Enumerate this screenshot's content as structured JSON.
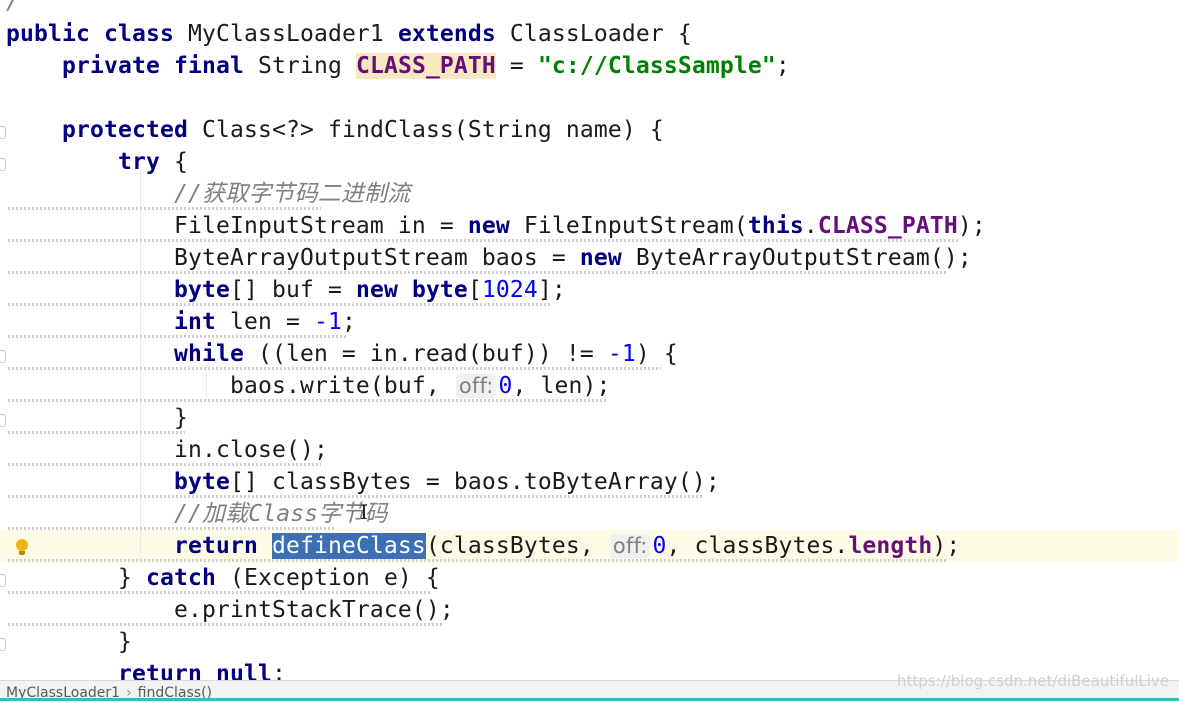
{
  "editor": {
    "lines": [
      {
        "tokens": [
          {
            "t": "/",
            "c": "cm"
          }
        ]
      },
      {
        "tokens": [
          {
            "t": "public class ",
            "c": "kw"
          },
          {
            "t": "MyClassLoader1 "
          },
          {
            "t": "extends ",
            "c": "kw"
          },
          {
            "t": "ClassLoader {"
          }
        ]
      },
      {
        "tokens": [
          {
            "t": "    "
          },
          {
            "t": "private final ",
            "c": "kw"
          },
          {
            "t": "String "
          },
          {
            "t": "CLASS_PATH",
            "c": "fld hl-const"
          },
          {
            "t": " = "
          },
          {
            "t": "\"c://ClassSample\"",
            "c": "st"
          },
          {
            "t": ";"
          }
        ]
      },
      {
        "tokens": []
      },
      {
        "tokens": [
          {
            "t": "    "
          },
          {
            "t": "protected ",
            "c": "kw"
          },
          {
            "t": "Class<?> findClass(String name) {"
          }
        ]
      },
      {
        "tokens": [
          {
            "t": "        "
          },
          {
            "t": "try ",
            "c": "kw"
          },
          {
            "t": "{"
          }
        ]
      },
      {
        "tokens": [
          {
            "t": "            "
          },
          {
            "t": "//获取字节码二进制流",
            "c": "cm"
          }
        ]
      },
      {
        "tokens": [
          {
            "t": "            FileInputStream in = "
          },
          {
            "t": "new ",
            "c": "kw"
          },
          {
            "t": "FileInputStream("
          },
          {
            "t": "this",
            "c": "kw"
          },
          {
            "t": "."
          },
          {
            "t": "CLASS_PATH",
            "c": "fld"
          },
          {
            "t": ");"
          }
        ]
      },
      {
        "tokens": [
          {
            "t": "            ByteArrayOutputStream baos = "
          },
          {
            "t": "new ",
            "c": "kw"
          },
          {
            "t": "ByteArrayOutputStream();"
          }
        ]
      },
      {
        "tokens": [
          {
            "t": "            "
          },
          {
            "t": "byte",
            "c": "kw"
          },
          {
            "t": "[] buf = "
          },
          {
            "t": "new byte",
            "c": "kw"
          },
          {
            "t": "["
          },
          {
            "t": "1024",
            "c": "nm"
          },
          {
            "t": "];"
          }
        ]
      },
      {
        "tokens": [
          {
            "t": "            "
          },
          {
            "t": "int ",
            "c": "kw"
          },
          {
            "t": "len = "
          },
          {
            "t": "-1",
            "c": "nm"
          },
          {
            "t": ";"
          }
        ]
      },
      {
        "tokens": [
          {
            "t": "            "
          },
          {
            "t": "while ",
            "c": "kw"
          },
          {
            "t": "((len = in.read(buf)) != "
          },
          {
            "t": "-1",
            "c": "nm"
          },
          {
            "t": ") {"
          }
        ]
      },
      {
        "tokens": [
          {
            "t": "                baos.write(buf, "
          },
          {
            "t": "off:",
            "c": "hint"
          },
          {
            "t": "0",
            "c": "nm"
          },
          {
            "t": ", len);"
          }
        ]
      },
      {
        "tokens": [
          {
            "t": "            }"
          }
        ]
      },
      {
        "tokens": [
          {
            "t": "            in.close();"
          }
        ]
      },
      {
        "tokens": [
          {
            "t": "            "
          },
          {
            "t": "byte",
            "c": "kw"
          },
          {
            "t": "[] classBytes = baos.toByteArray();"
          }
        ]
      },
      {
        "tokens": [
          {
            "t": "            "
          },
          {
            "t": "//加载Class字节码",
            "c": "cm"
          }
        ]
      },
      {
        "tokens": [
          {
            "t": "            "
          },
          {
            "t": "return ",
            "c": "kw"
          },
          {
            "t": "defineClass",
            "c": "sel"
          },
          {
            "t": "(classBytes, "
          },
          {
            "t": "off:",
            "c": "hint"
          },
          {
            "t": "0",
            "c": "nm"
          },
          {
            "t": ", classBytes."
          },
          {
            "t": "length",
            "c": "fld"
          },
          {
            "t": ");"
          }
        ],
        "current": true,
        "bulb": true
      },
      {
        "tokens": [
          {
            "t": "        } "
          },
          {
            "t": "catch ",
            "c": "kw"
          },
          {
            "t": "(Exception e) {"
          }
        ]
      },
      {
        "tokens": [
          {
            "t": "            e.printStackTrace();"
          }
        ]
      },
      {
        "tokens": [
          {
            "t": "        }"
          }
        ]
      },
      {
        "tokens": [
          {
            "t": "        "
          },
          {
            "t": "return null",
            "c": "kw"
          },
          {
            "t": ";"
          }
        ]
      }
    ]
  },
  "breadcrumb": {
    "class_name": "MyClassLoader1",
    "separator": "›",
    "method_name": "findClass()"
  },
  "watermark": "https://blog.csdn.net/diBeautifulLive",
  "icons": {
    "intention": "lightbulb-icon"
  },
  "colors": {
    "keyword": "#000080",
    "comment": "#808080",
    "string": "#008000",
    "number": "#0000ff",
    "field": "#660e7a",
    "selection": "#3d6fb5",
    "current_line": "#fdfbe6"
  }
}
